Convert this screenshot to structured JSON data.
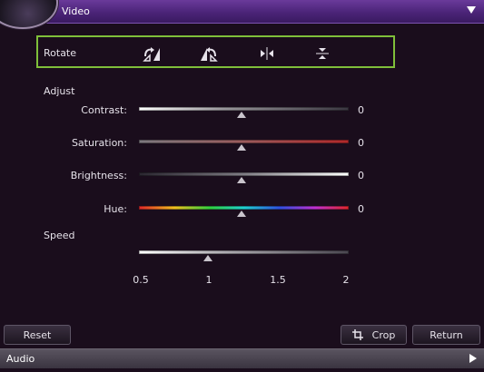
{
  "header": {
    "title": "Video"
  },
  "rotate": {
    "label": "Rotate",
    "buttons": [
      "rotate-right-icon",
      "rotate-left-icon",
      "flip-horizontal-icon",
      "flip-vertical-icon"
    ]
  },
  "adjust": {
    "label": "Adjust",
    "contrast": {
      "label": "Contrast:",
      "value": "0"
    },
    "saturation": {
      "label": "Saturation:",
      "value": "0"
    },
    "brightness": {
      "label": "Brightness:",
      "value": "0"
    },
    "hue": {
      "label": "Hue:",
      "value": "0"
    }
  },
  "speed": {
    "label": "Speed",
    "ticks": [
      "0.5",
      "1",
      "1.5",
      "2"
    ],
    "value": 1
  },
  "buttons": {
    "reset": "Reset",
    "crop": "Crop",
    "return": "Return"
  },
  "footer": {
    "title": "Audio"
  },
  "colors": {
    "accent": "#4b2478",
    "highlight": "#7fbf3a",
    "saturation": "#b0282a"
  }
}
